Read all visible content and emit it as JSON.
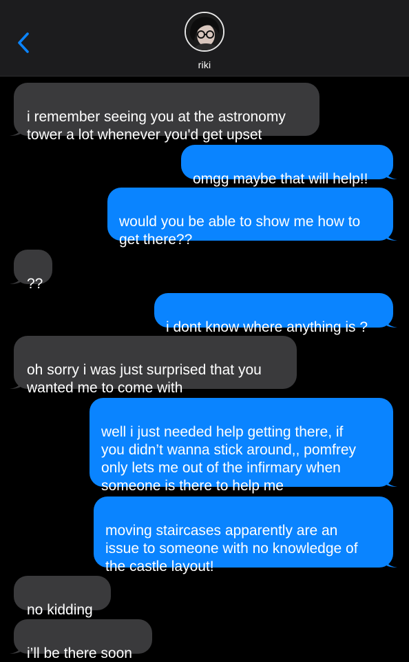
{
  "header": {
    "contact_name": "riki",
    "back_icon": "chevron-left-icon",
    "avatar_icon": "contact-avatar"
  },
  "colors": {
    "incoming_bubble": "#3a3a3c",
    "outgoing_bubble": "#0a84ff",
    "accent": "#0a84ff",
    "background": "#000000",
    "header_bg": "#1c1c1e"
  },
  "messages": [
    {
      "direction": "incoming",
      "text": "i remember seeing you at the astronomy\ntower a lot whenever you'd get upset"
    },
    {
      "direction": "outgoing",
      "text": "omgg maybe that will help!!"
    },
    {
      "direction": "outgoing",
      "text": "would you be able to show me how to\nget there??"
    },
    {
      "direction": "incoming",
      "text": "??"
    },
    {
      "direction": "outgoing",
      "text": "i dont know where anything is ?"
    },
    {
      "direction": "incoming",
      "text": "oh sorry i was just surprised that you\nwanted me to come with"
    },
    {
      "direction": "outgoing",
      "text": "well i just needed help getting there, if\nyou didn’t wanna stick around,, pomfrey\nonly lets me out of the infirmary when\nsomeone is there to help me"
    },
    {
      "direction": "outgoing",
      "text": "moving staircases apparently are an\nissue to someone with no knowledge of\nthe castle layout!"
    },
    {
      "direction": "incoming",
      "text": "no kidding"
    },
    {
      "direction": "incoming",
      "text": "i’ll be there soon"
    }
  ]
}
